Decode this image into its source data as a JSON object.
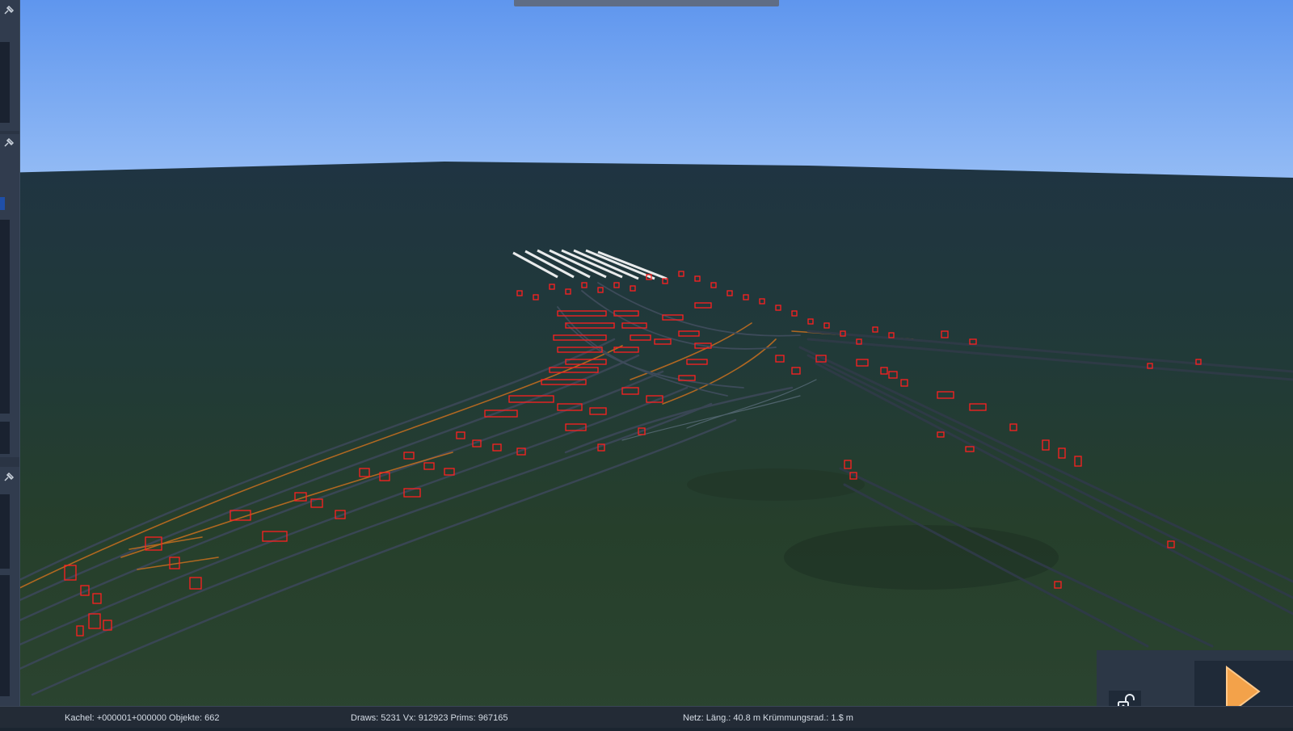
{
  "statusbar": {
    "tile": "Kachel: +000001+000000  Objekte: 662",
    "render": "Draws: 5231 Vx: 912923 Prims: 967165",
    "net": "Netz:  Läng.:   40.8 m Krümmungsrad.:  1.$ m"
  },
  "icons": {
    "pin": "pin-icon",
    "lock": "unlock-icon",
    "play": "play-icon"
  },
  "colors": {
    "sky_top": "#5f96ee",
    "sky_bottom": "#8fb8f5",
    "ground_far": "#1f3542",
    "ground_near": "#263e29",
    "marker": "#ff2020",
    "track_orange": "#d87a22",
    "play_accent": "#f3a24a"
  }
}
